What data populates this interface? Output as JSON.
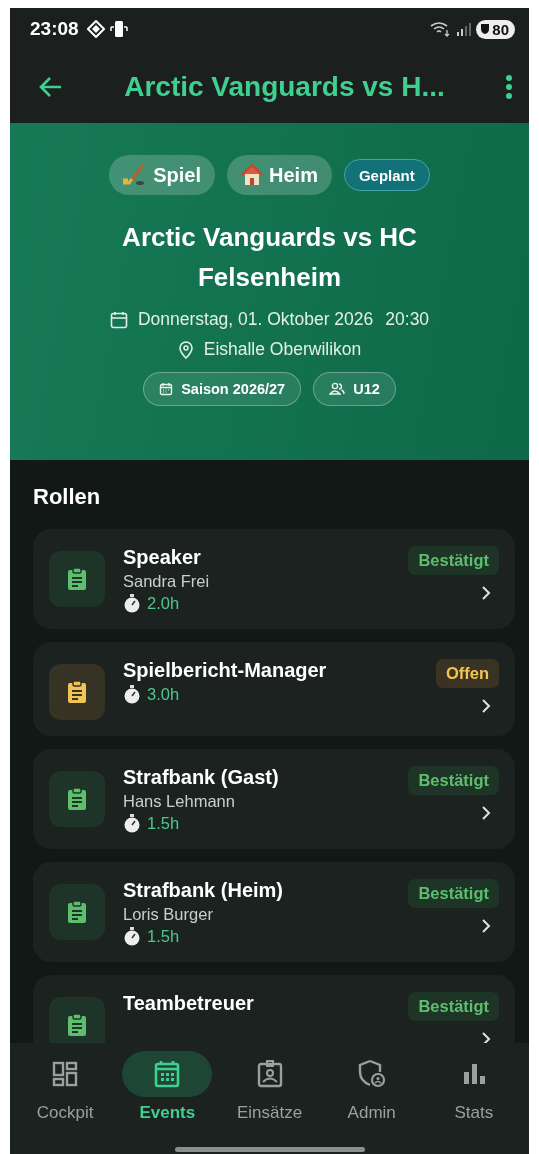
{
  "status_bar": {
    "time": "23:08",
    "battery": "80"
  },
  "app_bar": {
    "title": "Arctic Vanguards vs H..."
  },
  "event": {
    "tags": [
      {
        "label": "Spiel",
        "kind": "game"
      },
      {
        "label": "Heim",
        "kind": "home"
      },
      {
        "label": "Geplant",
        "kind": "status"
      }
    ],
    "title": "Arctic Vanguards vs HC Felsenheim",
    "date": "Donnerstag, 01. Oktober 2026",
    "time": "20:30",
    "location": "Eishalle Oberwilikon",
    "chips": [
      {
        "label": "Saison 2026/27",
        "kind": "season"
      },
      {
        "label": "U12",
        "kind": "team"
      }
    ]
  },
  "roles": {
    "heading": "Rollen",
    "items": [
      {
        "name": "Speaker",
        "person": "Sandra Frei",
        "hours": "2.0h",
        "status": {
          "label": "Bestätigt",
          "kind": "confirmed"
        }
      },
      {
        "name": "Spielbericht-Manager",
        "hours": "3.0h",
        "status": {
          "label": "Offen",
          "kind": "open"
        }
      },
      {
        "name": "Strafbank (Gast)",
        "person": "Hans Lehmann",
        "hours": "1.5h",
        "status": {
          "label": "Bestätigt",
          "kind": "confirmed"
        }
      },
      {
        "name": "Strafbank (Heim)",
        "person": "Loris Burger",
        "hours": "1.5h",
        "status": {
          "label": "Bestätigt",
          "kind": "confirmed"
        }
      },
      {
        "name": "Teambetreuer",
        "status": {
          "label": "Bestätigt",
          "kind": "confirmed"
        }
      }
    ]
  },
  "bottom_nav": [
    {
      "label": "Cockpit",
      "kind": "dashboard",
      "selected": false
    },
    {
      "label": "Events",
      "kind": "calendar",
      "selected": true
    },
    {
      "label": "Einsätze",
      "kind": "badge",
      "selected": false
    },
    {
      "label": "Admin",
      "kind": "admin",
      "selected": false
    },
    {
      "label": "Stats",
      "kind": "stats",
      "selected": false
    }
  ]
}
